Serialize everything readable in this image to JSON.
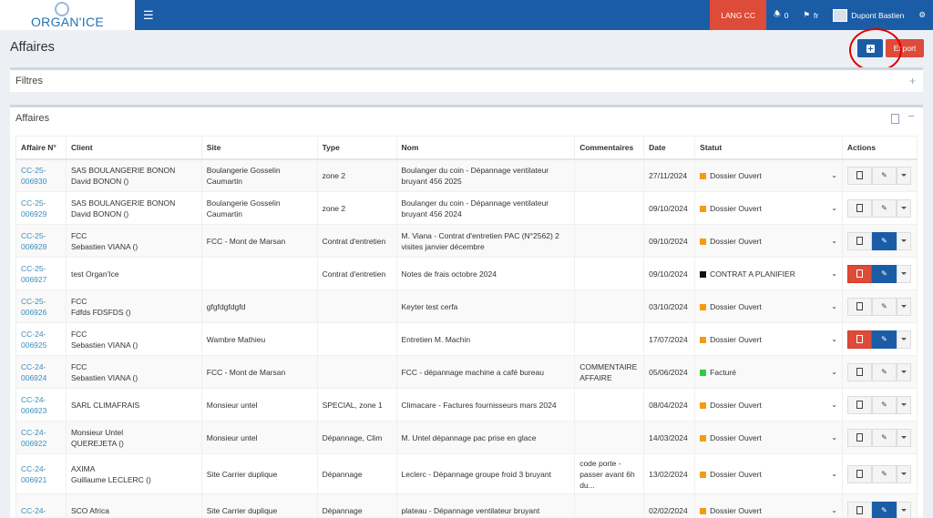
{
  "header": {
    "logo_text": "ORGAN'ICE",
    "menu_icon": "bars-icon",
    "lang_label": "LANG CC",
    "notifications_count": "0",
    "flag_label": "fr",
    "user_name": "Dupont Bastien",
    "settings_icon": "cogs-icon"
  },
  "page": {
    "title": "Affaires",
    "export_label": "Export",
    "add_icon": "plus-square-icon"
  },
  "filters": {
    "title": "Filtres",
    "toggle": "+"
  },
  "affaires": {
    "title": "Affaires",
    "collapse": "−",
    "columns": [
      "Affaire N°",
      "Client",
      "Site",
      "Type",
      "Nom",
      "Commentaires",
      "Date",
      "Statut",
      "Actions"
    ],
    "rows": [
      {
        "num": "CC-25-006930",
        "client1": "SAS BOULANGERIE BONON",
        "client2": "David BONON ()",
        "site": "Boulangerie Gosselin Caumartin",
        "type": "zone 2",
        "nom": "Boulanger du coin - Dépannage ventilateur bruyant 456 2025",
        "comment": "",
        "date": "27/11/2024",
        "statut": "Dossier Ouvert",
        "color": "#f39c12",
        "doc_red": false,
        "edit_blue": false
      },
      {
        "num": "CC-25-006929",
        "client1": "SAS BOULANGERIE BONON",
        "client2": "David BONON ()",
        "site": "Boulangerie Gosselin Caumartin",
        "type": "zone 2",
        "nom": "Boulanger du coin - Dépannage ventilateur bruyant 456 2024",
        "comment": "",
        "date": "09/10/2024",
        "statut": "Dossier Ouvert",
        "color": "#f39c12",
        "doc_red": false,
        "edit_blue": false
      },
      {
        "num": "CC-25-006928",
        "client1": "FCC",
        "client2": "Sebastien VIANA ()",
        "site": "FCC - Mont de Marsan",
        "type": "Contrat d'entretien",
        "nom": "M. Viana - Contrat d'entretien PAC (N°2562) 2 visites janvier décembre",
        "comment": "",
        "date": "09/10/2024",
        "statut": "Dossier Ouvert",
        "color": "#f39c12",
        "doc_red": false,
        "edit_blue": true
      },
      {
        "num": "CC-25-006927",
        "client1": "test Organ'Ice",
        "client2": "",
        "site": "",
        "type": "Contrat d'entretien",
        "nom": "Notes de frais octobre 2024",
        "comment": "",
        "date": "09/10/2024",
        "statut": "CONTRAT A PLANIFIER",
        "color": "#111111",
        "doc_red": true,
        "edit_blue": true
      },
      {
        "num": "CC-25-006926",
        "client1": "FCC",
        "client2": "Fdfds FDSFDS ()",
        "site": "gfgfdgfdgfd",
        "type": "",
        "nom": "Keyter test cerfa",
        "comment": "",
        "date": "03/10/2024",
        "statut": "Dossier Ouvert",
        "color": "#f39c12",
        "doc_red": false,
        "edit_blue": false
      },
      {
        "num": "CC-24-006925",
        "client1": "FCC",
        "client2": "Sebastien VIANA ()",
        "site": "Wambre Mathieu",
        "type": "",
        "nom": "Entretien M. Machin",
        "comment": "",
        "date": "17/07/2024",
        "statut": "Dossier Ouvert",
        "color": "#f39c12",
        "doc_red": true,
        "edit_blue": true
      },
      {
        "num": "CC-24-006924",
        "client1": "FCC",
        "client2": "Sebastien VIANA ()",
        "site": "FCC - Mont de Marsan",
        "type": "",
        "nom": "FCC - dépannage machine a café bureau",
        "comment": "COMMENTAIRE AFFAIRE",
        "date": "05/06/2024",
        "statut": "Facturé",
        "color": "#2ecc40",
        "doc_red": false,
        "edit_blue": false
      },
      {
        "num": "CC-24-006923",
        "client1": "SARL CLIMAFRAIS",
        "client2": "",
        "site": "Monsieur untel",
        "type": "SPECIAL, zone 1",
        "nom": "Climacare - Factures fournisseurs mars 2024",
        "comment": "",
        "date": "08/04/2024",
        "statut": "Dossier Ouvert",
        "color": "#f39c12",
        "doc_red": false,
        "edit_blue": false
      },
      {
        "num": "CC-24-006922",
        "client1": "Monsieur Untel",
        "client2": "QUEREJETA ()",
        "site": "Monsieur untel",
        "type": "Dépannage, Clim",
        "nom": "M. Untel dépannage pac prise en glace",
        "comment": "",
        "date": "14/03/2024",
        "statut": "Dossier Ouvert",
        "color": "#f39c12",
        "doc_red": false,
        "edit_blue": false
      },
      {
        "num": "CC-24-006921",
        "client1": "AXIMA",
        "client2": "Guillaume LECLERC ()",
        "site": "Site Carrier duplique",
        "type": "Dépannage",
        "nom": "Leclerc - Dépannage groupe froid 3 bruyant",
        "comment": "code porte - passer avant 6h du...",
        "date": "13/02/2024",
        "statut": "Dossier Ouvert",
        "color": "#f39c12",
        "doc_red": false,
        "edit_blue": false
      },
      {
        "num": "CC-24-",
        "client1": "SCO Africa",
        "client2": "",
        "site": "Site Carrier duplique",
        "type": "Dépannage",
        "nom": "plateau - Dépannage ventilateur bruyant",
        "comment": "",
        "date": "02/02/2024",
        "statut": "Dossier Ouvert",
        "color": "#f39c12",
        "doc_red": false,
        "edit_blue": true
      }
    ]
  }
}
